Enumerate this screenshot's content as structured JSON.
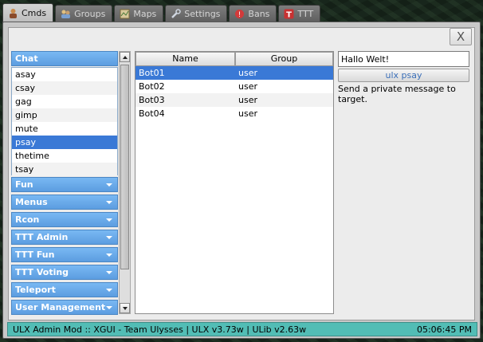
{
  "tabs": [
    {
      "label": "Cmds",
      "icon": "user-icon"
    },
    {
      "label": "Groups",
      "icon": "groups-icon"
    },
    {
      "label": "Maps",
      "icon": "map-icon"
    },
    {
      "label": "Settings",
      "icon": "wrench-icon"
    },
    {
      "label": "Bans",
      "icon": "ban-icon"
    },
    {
      "label": "TTT",
      "icon": "ttt-icon"
    }
  ],
  "close_label": "X",
  "categories": {
    "chat": "Chat",
    "fun": "Fun",
    "menus": "Menus",
    "rcon": "Rcon",
    "ttt_admin": "TTT Admin",
    "ttt_fun": "TTT Fun",
    "ttt_voting": "TTT Voting",
    "teleport": "Teleport",
    "user_management": "User Management"
  },
  "chat_commands": [
    "asay",
    "csay",
    "gag",
    "gimp",
    "mute",
    "psay",
    "thetime",
    "tsay"
  ],
  "selected_command": "psay",
  "targets": {
    "headers": {
      "name": "Name",
      "group": "Group"
    },
    "rows": [
      {
        "name": "Bot01",
        "group": "user"
      },
      {
        "name": "Bot02",
        "group": "user"
      },
      {
        "name": "Bot03",
        "group": "user"
      },
      {
        "name": "Bot04",
        "group": "user"
      }
    ],
    "selected": "Bot01"
  },
  "args": {
    "message_value": "Hallo Welt!",
    "run_label": "ulx psay",
    "help_text": "Send a private message to target."
  },
  "status": {
    "left": "ULX Admin Mod :: XGUI - Team Ulysses |  ULX v3.73w  |  ULib v2.63w",
    "time": "05:06:45 PM"
  },
  "colors": {
    "accent_blue": "#5c9de0",
    "selection": "#3a79d6",
    "status_bar": "#52bdb5"
  }
}
